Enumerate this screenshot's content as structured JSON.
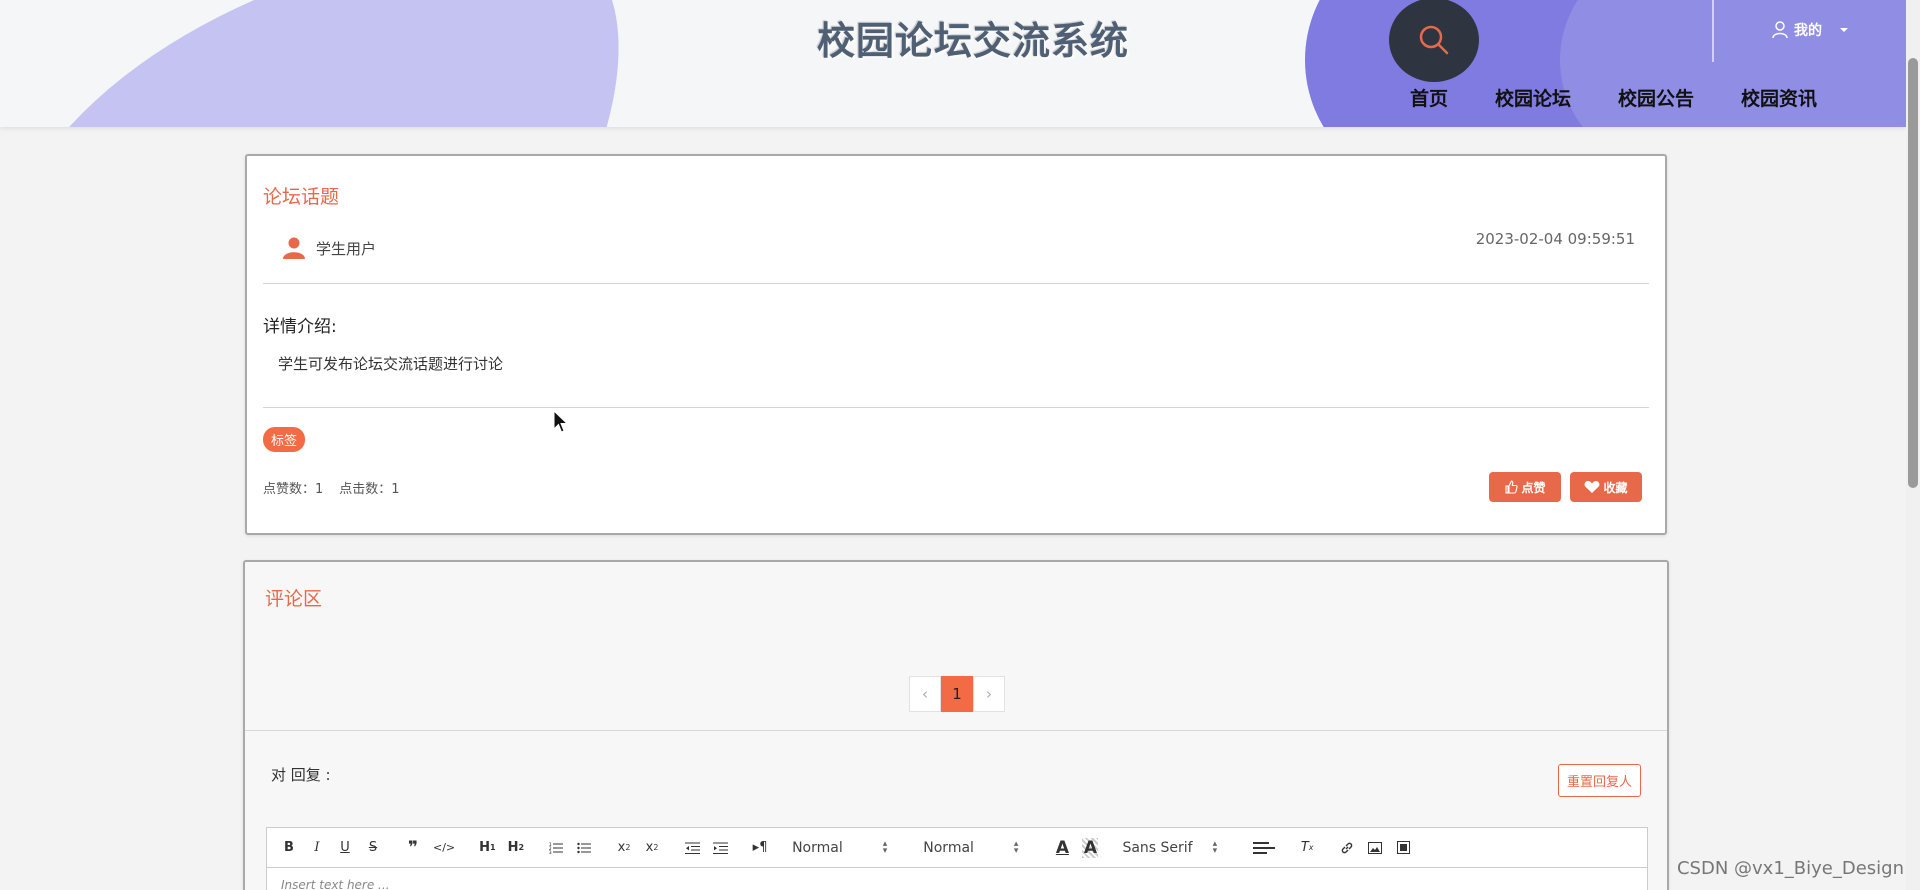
{
  "header": {
    "site_title": "校园论坛交流系统",
    "user_menu_label": "我的",
    "nav": [
      "首页",
      "校园论坛",
      "校园公告",
      "校园资讯"
    ]
  },
  "topic_card": {
    "title": "论坛话题",
    "author": "学生用户",
    "timestamp": "2023-02-04 09:59:51",
    "detail_label": "详情介绍:",
    "detail_text": "学生可发布论坛交流话题进行讨论",
    "tag": "标签",
    "likes_label": "点赞数：1",
    "clicks_label": "点击数：1",
    "like_button": "点赞",
    "favorite_button": "收藏"
  },
  "comments": {
    "title": "评论区",
    "pagination": {
      "prev": "‹",
      "current": "1",
      "next": "›"
    },
    "reply_label": "对 回复 :",
    "reset_button": "重置回复人",
    "editor": {
      "header_select": "Normal",
      "size_select": "Normal",
      "font_select": "Sans Serif",
      "placeholder": "Insert text here ..."
    }
  },
  "watermark": "CSDN @vx1_Biye_Design",
  "colors": {
    "accent": "#e8694a",
    "purple": "#7f7be0",
    "light_purple": "#c5c3f2",
    "dark": "#2f3540"
  }
}
